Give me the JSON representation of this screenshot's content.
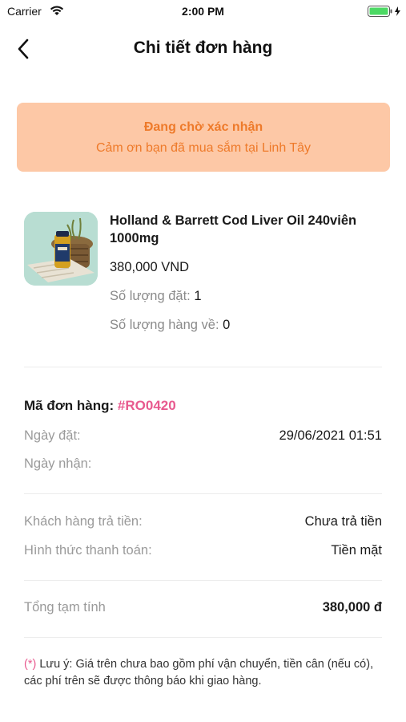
{
  "status_bar": {
    "carrier": "Carrier",
    "time": "2:00 PM",
    "battery_color": "#4cd964"
  },
  "header": {
    "title": "Chi tiết đơn hàng"
  },
  "banner": {
    "title": "Đang chờ xác nhận",
    "subtitle": "Cảm ơn bạn đã mua sắm tại Linh Tây",
    "background": "#fdc8a6",
    "text_color": "#ee7a2a"
  },
  "product": {
    "name": "Holland & Barrett Cod Liver Oil 240viên 1000mg",
    "price": "380,000 VND",
    "ordered_qty_label": "Số lượng đặt:",
    "ordered_qty_value": "1",
    "received_qty_label": "Số lượng hàng về:",
    "received_qty_value": "0"
  },
  "order": {
    "code_label": "Mã đơn hàng:",
    "code_value": "#RO0420",
    "order_date_label": "Ngày đặt:",
    "order_date_value": "29/06/2021 01:51",
    "receive_date_label": "Ngày nhận:",
    "receive_date_value": ""
  },
  "payment": {
    "customer_pay_label": "Khách hàng trả tiền:",
    "customer_pay_value": "Chưa trả tiền",
    "method_label": "Hình thức thanh toán:",
    "method_value": "Tiền mặt"
  },
  "summary": {
    "subtotal_label": "Tổng tạm tính",
    "subtotal_value": "380,000 đ"
  },
  "note": {
    "mark": "(*)",
    "text": "Lưu ý: Giá trên chưa bao gồm phí vận chuyển, tiền cân (nếu có), các phí trên sẽ được thông báo khi giao hàng."
  },
  "accent_color": "#e85a8f"
}
